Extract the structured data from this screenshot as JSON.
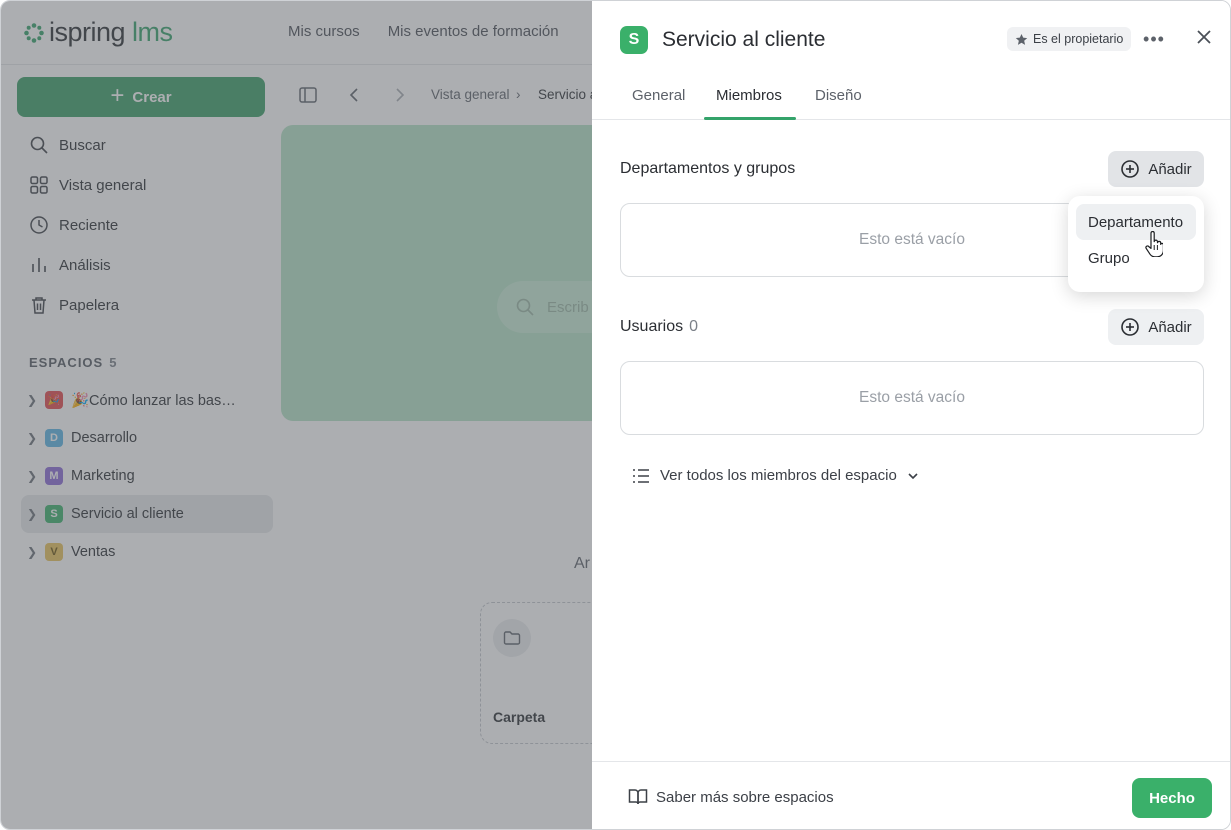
{
  "app": {
    "logo_main": "ispring",
    "logo_accent": "lms",
    "top_nav": [
      "Mis cursos",
      "Mis eventos de formación"
    ]
  },
  "sidebar": {
    "create_label": "Crear",
    "items": [
      {
        "label": "Buscar",
        "icon": "search-icon"
      },
      {
        "label": "Vista general",
        "icon": "grid-icon"
      },
      {
        "label": "Reciente",
        "icon": "clock-icon"
      },
      {
        "label": "Análisis",
        "icon": "chart-icon"
      },
      {
        "label": "Papelera",
        "icon": "trash-icon"
      }
    ],
    "spaces_heading": "ESPACIOS",
    "spaces_count": "5",
    "spaces": [
      {
        "badge": "🎉",
        "label": "🎉Cómo lanzar las bas…",
        "color": "#e5484d"
      },
      {
        "badge": "D",
        "label": "Desarrollo",
        "color": "#5bb4e5"
      },
      {
        "badge": "M",
        "label": "Marketing",
        "color": "#8b6ad6"
      },
      {
        "badge": "S",
        "label": "Servicio al cliente",
        "color": "#3ab06a"
      },
      {
        "badge": "V",
        "label": "Ventas",
        "color": "#e9c25a"
      }
    ]
  },
  "main": {
    "breadcrumb_root": "Vista general",
    "breadcrumb_current": "Servicio a",
    "search_placeholder": "Escrib",
    "partial_text": "Ar",
    "folder_label": "Carpeta"
  },
  "panel": {
    "badge": "S",
    "title": "Servicio al cliente",
    "owner_label": "Es el propietario",
    "more_label": "•••",
    "tabs": [
      "General",
      "Miembros",
      "Diseño"
    ],
    "active_tab": "Miembros",
    "departments": {
      "title": "Departamentos y grupos",
      "add_label": "Añadir",
      "empty_text": "Esto está vacío"
    },
    "users": {
      "title": "Usuarios",
      "count": "0",
      "add_label": "Añadir",
      "empty_text": "Esto está vacío"
    },
    "dropdown": [
      "Departamento",
      "Grupo"
    ],
    "view_all": "Ver todos los miembros del espacio",
    "learn_more": "Saber más sobre espacios",
    "done_label": "Hecho"
  }
}
